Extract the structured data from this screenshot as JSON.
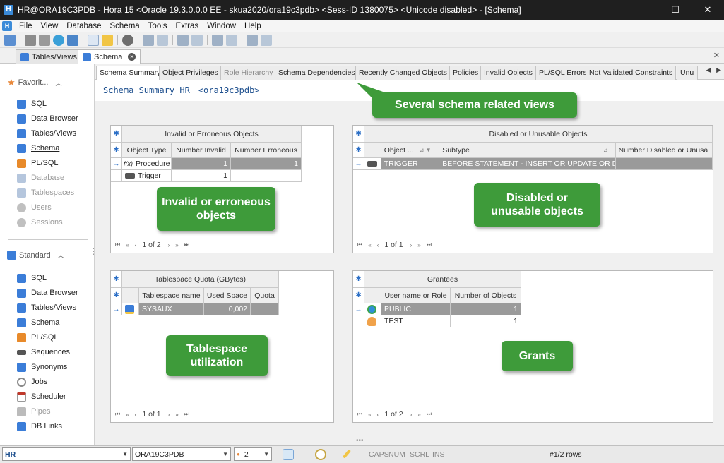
{
  "window": {
    "title": "HR@ORA19C3PDB - Hora 15   <Oracle 19.3.0.0.0 EE   - skua2020/ora19c3pdb>   <Sess-ID 1380075> <Unicode disabled> - [Schema]",
    "app_icon": "H",
    "controls": {
      "minimize": "—",
      "maximize": "☐",
      "close": "✕"
    }
  },
  "menu": [
    "File",
    "View",
    "Database",
    "Schema",
    "Tools",
    "Extras",
    "Window",
    "Help"
  ],
  "doc_tabs": [
    {
      "label": "Tables/Views"
    },
    {
      "label": "Schema"
    }
  ],
  "navigator": {
    "favorites": {
      "label": "Favorit...",
      "items": [
        {
          "label": "SQL",
          "color": "#3b7dd8"
        },
        {
          "label": "Data Browser",
          "color": "#3b7dd8"
        },
        {
          "label": "Tables/Views",
          "color": "#3b7dd8"
        },
        {
          "label": "Schema",
          "color": "#3b7dd8"
        },
        {
          "label": "PL/SQL",
          "color": "#e88a2a"
        },
        {
          "label": "Database",
          "color": "#b5c6dd"
        },
        {
          "label": "Tablespaces",
          "color": "#b5c6dd"
        },
        {
          "label": "Users",
          "color": "#c0c0c0"
        },
        {
          "label": "Sessions",
          "color": "#c0c0c0"
        }
      ]
    },
    "standard": {
      "label": "Standard",
      "items": [
        {
          "label": "SQL",
          "color": "#3b7dd8"
        },
        {
          "label": "Data Browser",
          "color": "#3b7dd8"
        },
        {
          "label": "Tables/Views",
          "color": "#3b7dd8"
        },
        {
          "label": "Schema",
          "color": "#3b7dd8"
        },
        {
          "label": "PL/SQL",
          "color": "#e88a2a"
        },
        {
          "label": "Sequences",
          "color": "#555555"
        },
        {
          "label": "Synonyms",
          "color": "#3b7dd8"
        },
        {
          "label": "Jobs",
          "color": "#8a8a8a"
        },
        {
          "label": "Scheduler",
          "color": "#c0392b"
        },
        {
          "label": "Pipes",
          "color": "#bbbbbb"
        },
        {
          "label": "DB Links",
          "color": "#3b7dd8"
        }
      ]
    }
  },
  "subtabs": [
    "Schema Summary",
    "Object Privileges",
    "Role Hierarchy",
    "Schema Dependencies",
    "Recently Changed Objects",
    "Policies",
    "Invalid Objects",
    "PL/SQL Errors",
    "Not Validated Constraints",
    "Unu"
  ],
  "summary": {
    "title": "Schema Summary HR",
    "db": "<ora19c3pdb>"
  },
  "panels": {
    "invalid": {
      "title": "Invalid or Erroneous Objects",
      "columns": [
        "Object Type",
        "Number Invalid",
        "Number Erroneous"
      ],
      "rows": [
        {
          "type": "Procedure",
          "icon": "f(x)",
          "invalid": "1",
          "erroneous": "1"
        },
        {
          "type": "Trigger",
          "invalid": "1",
          "erroneous": ""
        }
      ],
      "pager": "1 of 2"
    },
    "disabled": {
      "title": "Disabled or Unusable Objects",
      "columns": [
        "Object ...",
        "Subtype",
        "Number Disabled or Unusa"
      ],
      "rows": [
        {
          "object": "TRIGGER",
          "subtype": "BEFORE STATEMENT - INSERT OR UPDATE OR DELETE",
          "count": ""
        }
      ],
      "pager": "1 of 1"
    },
    "quota": {
      "title": "Tablespace Quota (GBytes)",
      "columns": [
        "Tablespace name",
        "Used Space",
        "Quota"
      ],
      "rows": [
        {
          "name": "SYSAUX",
          "used": "0,002",
          "quota": ""
        }
      ],
      "pager": "1 of 1"
    },
    "grantees": {
      "title": "Grantees",
      "columns": [
        "User name or Role",
        "Number of Objects"
      ],
      "rows": [
        {
          "name": "PUBLIC",
          "count": "1"
        },
        {
          "name": "TEST",
          "count": "1"
        }
      ],
      "pager": "1 of 2"
    }
  },
  "callouts": {
    "views": "Several schema related views",
    "invalid": "Invalid or erroneous objects",
    "disabled": "Disabled or unusable objects",
    "tablespace": "Tablespace utilization",
    "grants": "Grants"
  },
  "status": {
    "schema": "HR",
    "db": "ORA19C3PDB",
    "count": "2",
    "flags": [
      "CAPS",
      "NUM",
      "SCRL",
      "INS"
    ],
    "rows": "#1/2 rows"
  },
  "colors": {
    "callout": "#3e9b3a",
    "accent": "#3b7dd8",
    "selection": "#9a9a9a"
  }
}
